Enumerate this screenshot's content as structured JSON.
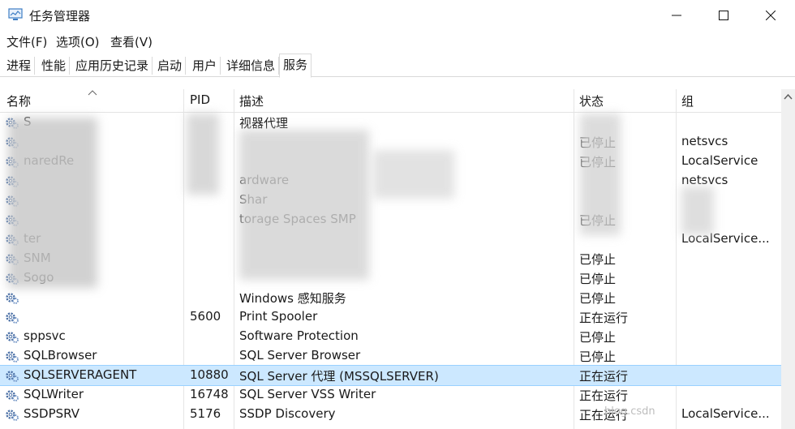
{
  "window": {
    "title": "任务管理器",
    "controls": {
      "minimize": "—",
      "maximize": "☐",
      "close": "✕"
    }
  },
  "menu": [
    "文件(F)",
    "选项(O)",
    "查看(V)"
  ],
  "tabs": [
    {
      "label": "进程",
      "active": false
    },
    {
      "label": "性能",
      "active": false
    },
    {
      "label": "应用历史记录",
      "active": false
    },
    {
      "label": "启动",
      "active": false
    },
    {
      "label": "用户",
      "active": false
    },
    {
      "label": "详细信息",
      "active": false
    },
    {
      "label": "服务",
      "active": true
    }
  ],
  "columns": [
    "名称",
    "PID",
    "描述",
    "状态",
    "组"
  ],
  "rows": [
    {
      "name": "S",
      "pid": "",
      "desc": "视器代理",
      "status": "",
      "group": ""
    },
    {
      "name": "",
      "pid": "",
      "desc": "",
      "status": "已停止",
      "group": "netsvcs"
    },
    {
      "name": "naredRe",
      "pid": "",
      "desc": "",
      "status": "已停止",
      "group": "LocalService"
    },
    {
      "name": "",
      "pid": "",
      "desc": "ardware",
      "status": "",
      "group": "netsvcs"
    },
    {
      "name": "",
      "pid": "",
      "desc": "Shar",
      "status": "",
      "group": ""
    },
    {
      "name": "",
      "pid": "",
      "desc": "torage Spaces SMP",
      "status": "已停止",
      "group": ""
    },
    {
      "name": "ter",
      "pid": "",
      "desc": "",
      "status": "",
      "group": "LocalService..."
    },
    {
      "name": "SNM",
      "pid": "",
      "desc": "",
      "status": "已停止",
      "group": ""
    },
    {
      "name": "Sogo",
      "pid": "",
      "desc": "",
      "status": "已停止",
      "group": ""
    },
    {
      "name": "",
      "pid": "",
      "desc": "Windows 感知服务",
      "status": "已停止",
      "group": ""
    },
    {
      "name": "",
      "pid": "5600",
      "desc": "Print Spooler",
      "status": "正在运行",
      "group": ""
    },
    {
      "name": "sppsvc",
      "pid": "",
      "desc": "Software Protection",
      "status": "已停止",
      "group": ""
    },
    {
      "name": "SQLBrowser",
      "pid": "",
      "desc": "SQL Server Browser",
      "status": "已停止",
      "group": ""
    },
    {
      "name": "SQLSERVERAGENT",
      "pid": "10880",
      "desc": "SQL Server 代理 (MSSQLSERVER)",
      "status": "正在运行",
      "group": "",
      "selected": true
    },
    {
      "name": "SQLWriter",
      "pid": "16748",
      "desc": "SQL Server VSS Writer",
      "status": "正在运行",
      "group": ""
    },
    {
      "name": "SSDPSRV",
      "pid": "5176",
      "desc": "SSDP Discovery",
      "status": "正在运行",
      "group": "LocalService..."
    }
  ],
  "watermark": "blog.csdn"
}
